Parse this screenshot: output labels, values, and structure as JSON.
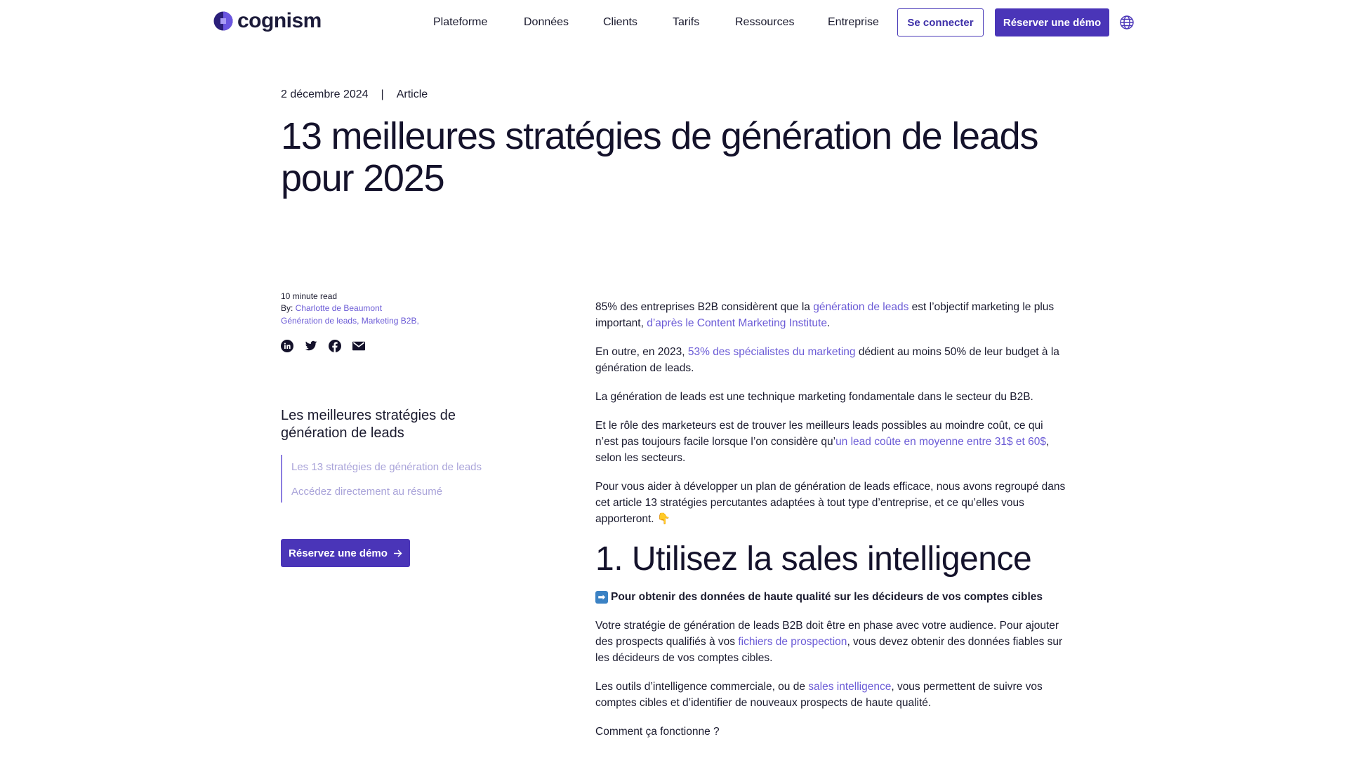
{
  "header": {
    "logo_text": "cognism",
    "nav": [
      "Plateforme",
      "Données",
      "Clients",
      "Tarifs",
      "Ressources",
      "Entreprise"
    ],
    "login_label": "Se connecter",
    "demo_label": "Réserver une démo",
    "globe_icon": "globe-icon"
  },
  "article": {
    "date": "2 décembre 2024",
    "separator": "|",
    "type": "Article",
    "title": "13 meilleures stratégies de génération de leads pour 2025"
  },
  "sidebar": {
    "read_time": "10 minute read",
    "by_label": "By: ",
    "author": "Charlotte de Beaumont",
    "tags": "Génération de leads, Marketing B2B,",
    "socials": [
      "linkedin-icon",
      "twitter-icon",
      "facebook-icon",
      "email-icon"
    ],
    "toc_title": "Les meilleures stratégies de génération de leads",
    "toc_items": [
      "Les 13 stratégies de génération de leads",
      "Accédez directement au résumé"
    ],
    "demo_label": "Réservez une démo"
  },
  "body": {
    "p1_a": "85% des entreprises B2B considèrent que la ",
    "p1_link1": "génération de leads",
    "p1_b": " est l’objectif marketing le plus important, ",
    "p1_link2": "d’après le Content Marketing Institute",
    "p1_c": ".",
    "p2_a": "En outre, en 2023, ",
    "p2_link": "53% des spécialistes du marketing",
    "p2_b": " dédient au moins 50% de leur budget à la génération de leads.",
    "p3": "La génération de leads est une technique marketing fondamentale dans le secteur du B2B.",
    "p4_a": "Et le rôle des marketeurs est de trouver les meilleurs leads possibles au moindre coût, ce qui n’est pas toujours facile lorsque l’on considère qu’",
    "p4_link": "un lead coûte en moyenne entre 31$ et 60$",
    "p4_b": ", selon les secteurs.",
    "p5": "Pour vous aider à développer un plan de génération de leads efficace, nous avons regroupé dans cet article 13 stratégies percutantes adaptées à tout type d’entreprise, et ce qu’elles vous apporteront. 👇",
    "h2": "1. Utilisez la sales intelligence",
    "callout_icon": "➡",
    "callout": "Pour obtenir des données de haute qualité sur les décideurs de vos comptes cibles",
    "p6_a": "Votre stratégie de génération de leads B2B doit être en phase avec votre audience. Pour ajouter des prospects qualifiés à vos ",
    "p6_link": "fichiers de prospection",
    "p6_b": ", vous devez obtenir des données fiables sur les décideurs de vos comptes cibles.",
    "p7_a": "Les outils d’intelligence commerciale, ou de ",
    "p7_link": "sales intelligence",
    "p7_b": ", vous permettent de suivre vos comptes cibles et d’identifier de nouveaux prospects de haute qualité.",
    "p8": "Comment ça fonctionne ?"
  },
  "colors": {
    "brand": "#4a35b8",
    "link": "#6b5bd6",
    "toc_text": "#a9a3d9"
  }
}
